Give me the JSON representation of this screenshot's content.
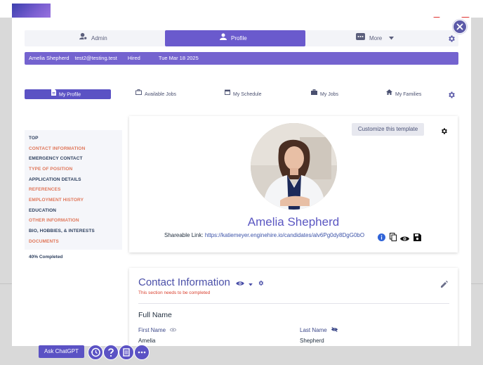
{
  "top_tabs": [
    {
      "label": "Admin",
      "icon": "admin-icon"
    },
    {
      "label": "Profile",
      "icon": "person-icon"
    },
    {
      "label": "More",
      "icon": "chat-icon"
    }
  ],
  "info_bar": {
    "name": "Amelia Shepherd",
    "email": "test2@testing.test",
    "status": "Hired",
    "date": "Tue Mar 18 2025"
  },
  "sub_tabs": [
    {
      "label": "My Profile",
      "icon": "document-icon"
    },
    {
      "label": "Available Jobs",
      "icon": "briefcase-icon"
    },
    {
      "label": "My Schedule",
      "icon": "calendar-icon"
    },
    {
      "label": "My Jobs",
      "icon": "briefcase-filled-icon"
    },
    {
      "label": "My Families",
      "icon": "home-icon"
    }
  ],
  "sidebar": {
    "items": [
      {
        "label": "TOP",
        "status": "ok"
      },
      {
        "label": "CONTACT INFORMATION",
        "status": "incomplete"
      },
      {
        "label": "EMERGENCY CONTACT",
        "status": "ok"
      },
      {
        "label": "TYPE OF POSITION",
        "status": "incomplete"
      },
      {
        "label": "APPLICATION DETAILS",
        "status": "ok"
      },
      {
        "label": "REFERENCES",
        "status": "incomplete"
      },
      {
        "label": "EMPLOYMENT HISTORY",
        "status": "incomplete"
      },
      {
        "label": "EDUCATION",
        "status": "ok"
      },
      {
        "label": "OTHER INFORMATION",
        "status": "incomplete"
      },
      {
        "label": "BIO, HOBBIES, & INTERESTS",
        "status": "ok"
      },
      {
        "label": "DOCUMENTS",
        "status": "incomplete"
      }
    ],
    "completed": "40% Completed"
  },
  "profile": {
    "customize_label": "Customize this template",
    "name": "Amelia Shepherd",
    "share_label": "Shareable Link:",
    "share_link": "https://katiemeyer.enginehire.io/candidates/alv6Pg0dy8DgG0bO"
  },
  "contact": {
    "title": "Contact Information",
    "warning": "This section needs to be completed",
    "subtitle": "Full Name",
    "first_label": "First Name",
    "first_value": "Amelia",
    "last_label": "Last Name",
    "last_value": "Shepherd"
  },
  "bottom": {
    "ask_label": "Ask ChatGPT"
  },
  "colors": {
    "accent": "#6a5acd",
    "warning": "#e0775a",
    "ok": "#2d3f5e"
  }
}
